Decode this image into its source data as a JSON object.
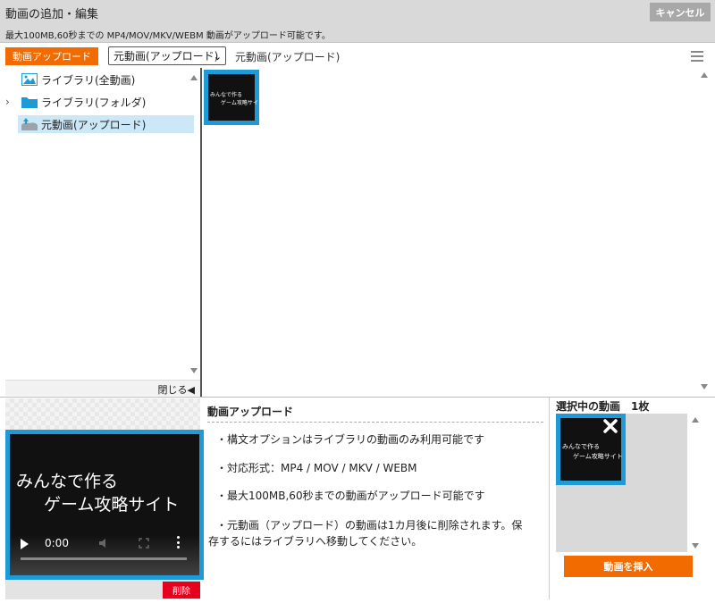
{
  "header": {
    "title": "動画の追加・編集",
    "cancel_label": "キャンセル",
    "note": "最大100MB,60秒までの MP4/MOV/MKV/WEBM 動画がアップロード可能です。"
  },
  "toolbar": {
    "upload_label": "動画アップロード",
    "folder_select_value": "元動画(アップロード)",
    "breadcrumb": "元動画(アップロード)"
  },
  "tree": {
    "items": [
      {
        "label": "ライブラリ(全動画)",
        "icon": "image-icon",
        "selected": false
      },
      {
        "label": "ライブラリ(フォルダ)",
        "icon": "folder-icon",
        "selected": false,
        "expandable": true
      },
      {
        "label": "元動画(アップロード)",
        "icon": "upload-folder-icon",
        "selected": true
      }
    ],
    "close_label": "閉じる◀"
  },
  "grid": {
    "thumbnails": [
      {
        "line1": "みんなで作る",
        "line2": "ゲーム攻略サイト",
        "selected": true
      }
    ]
  },
  "preview": {
    "title_line1": "みんなで作る",
    "title_line2": "ゲーム攻略サイト",
    "time": "0:00",
    "progress": 0,
    "delete_label": "削除"
  },
  "info": {
    "title": "動画アップロード",
    "bullets": [
      "・構文オプションはライブラリの動画のみ利用可能です",
      "・対応形式：MP4 / MOV / MKV / WEBM",
      "・最大100MB,60秒までの動画がアップロード可能です",
      "・元動画（アップロード）の動画は1カ月後に削除されます。保",
      "存するにはライブラリへ移動してください。"
    ]
  },
  "selected": {
    "title": "選択中の動画　1枚",
    "thumb_line1": "みんなで作る",
    "thumb_line2": "ゲーム攻略サイト",
    "insert_label": "動画を挿入"
  },
  "colors": {
    "accent_orange": "#f26b00",
    "selection_blue": "#1e9bd7",
    "delete_red": "#e6001e",
    "tree_selected_bg": "#cce8f7"
  }
}
